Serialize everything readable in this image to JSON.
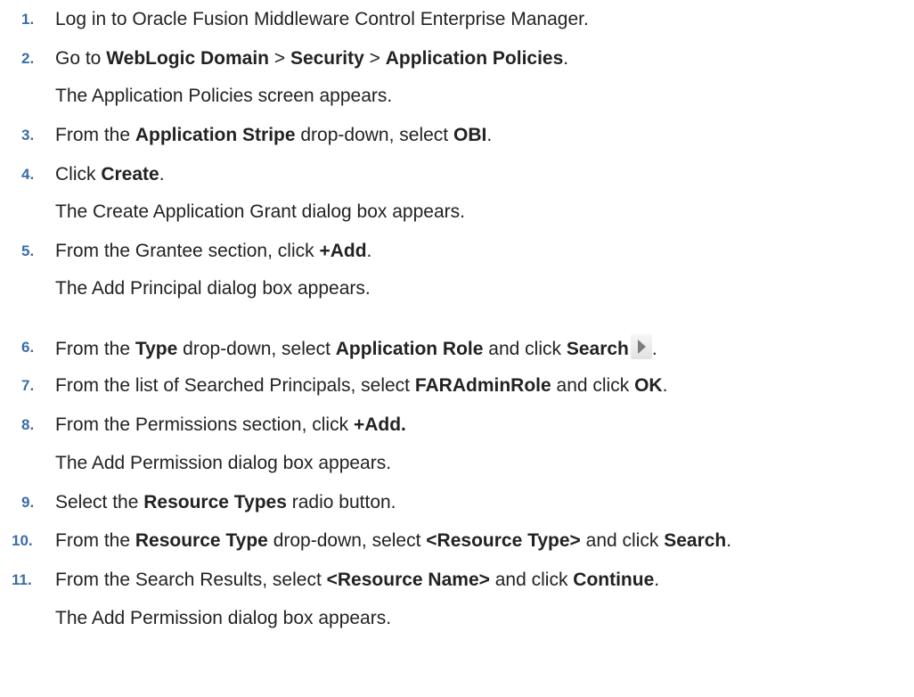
{
  "steps": [
    {
      "num": "1.",
      "parts": [
        "Log in to Oracle Fusion Middleware Control Enterprise Manager."
      ]
    },
    {
      "num": "2.",
      "parts": [
        "Go to ",
        "WebLogic Domain",
        " > ",
        "Security",
        " > ",
        "Application Policies",
        "."
      ],
      "note": "The Application Policies screen appears."
    },
    {
      "num": "3.",
      "parts": [
        "From the ",
        "Application Stripe",
        " drop-down, select ",
        "OBI",
        "."
      ]
    },
    {
      "num": "4.",
      "parts": [
        "Click ",
        "Create",
        "."
      ],
      "note": "The Create Application Grant dialog box appears."
    },
    {
      "num": "5.",
      "parts": [
        "From the Grantee section, click ",
        "+Add",
        "."
      ],
      "note": "The Add Principal dialog box appears."
    },
    {
      "num": "6.",
      "parts": [
        "From the ",
        "Type",
        " drop-down, select ",
        "Application Role",
        " and click ",
        "Search",
        "."
      ],
      "icon": "search-arrow-icon"
    },
    {
      "num": "7.",
      "parts": [
        "From the list of Searched Principals, select ",
        "FARAdminRole",
        " and click ",
        "OK",
        "."
      ]
    },
    {
      "num": "8.",
      "parts": [
        "From the Permissions section, click ",
        "+Add."
      ],
      "note": "The Add Permission dialog box appears."
    },
    {
      "num": "9.",
      "parts": [
        "Select the ",
        "Resource Types",
        " radio button."
      ]
    },
    {
      "num": "10.",
      "parts": [
        "From the ",
        "Resource Type",
        " drop-down, select ",
        "<Resource Type>",
        " and click ",
        "Search",
        "."
      ]
    },
    {
      "num": "11.",
      "parts": [
        "From the Search Results, select ",
        "<Resource Name>",
        " and click ",
        "Continue",
        "."
      ],
      "note": "The Add Permission dialog box appears."
    }
  ]
}
